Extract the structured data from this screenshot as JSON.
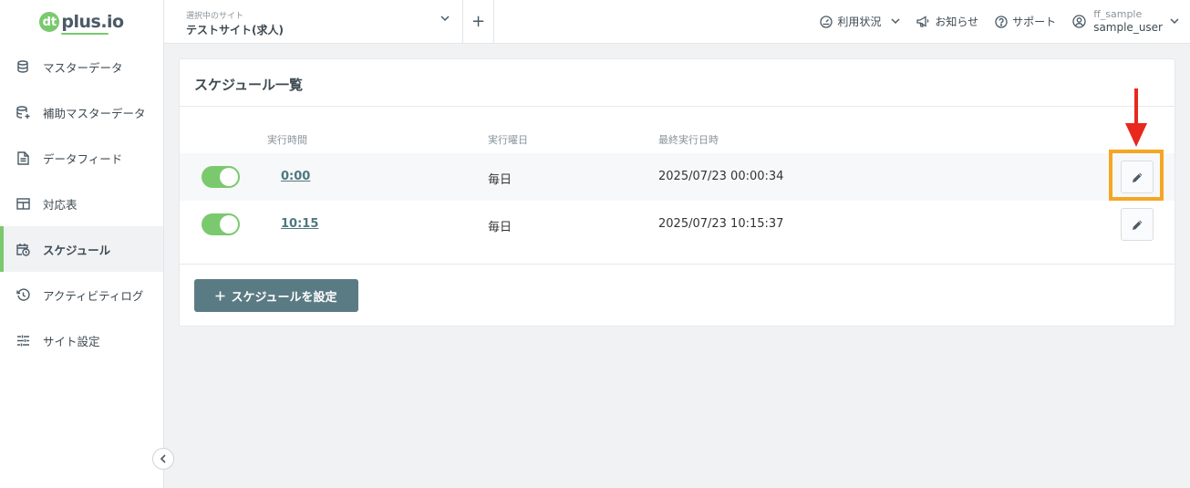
{
  "logo": {
    "mark": "dt",
    "text": "plus.io"
  },
  "sidebar": {
    "items": [
      {
        "label": "マスターデータ",
        "icon": "database-icon"
      },
      {
        "label": "補助マスターデータ",
        "icon": "database-plus-icon"
      },
      {
        "label": "データフィード",
        "icon": "file-icon"
      },
      {
        "label": "対応表",
        "icon": "table-icon"
      },
      {
        "label": "スケジュール",
        "icon": "calendar-clock-icon",
        "active": true
      },
      {
        "label": "アクティビティログ",
        "icon": "history-icon"
      },
      {
        "label": "サイト設定",
        "icon": "sliders-icon"
      }
    ]
  },
  "header": {
    "site_label": "選択中のサイト",
    "site_name": "テストサイト(求人)",
    "add_site": "+",
    "usage": "利用状況",
    "news": "お知らせ",
    "support": "サポート",
    "user_top": "ff_sample",
    "user_bottom": "sample_user"
  },
  "schedule": {
    "title": "スケジュール一覧",
    "columns": [
      "実行時間",
      "実行曜日",
      "最終実行日時"
    ],
    "rows": [
      {
        "enabled": true,
        "time": "0:00",
        "day": "毎日",
        "last_run": "2025/07/23 00:00:34"
      },
      {
        "enabled": true,
        "time": "10:15",
        "day": "毎日",
        "last_run": "2025/07/23 10:15:37"
      }
    ],
    "add_button": "スケジュールを設定"
  },
  "colors": {
    "accent_green": "#7ac96e",
    "button_slate": "#5b7b84",
    "highlight_orange": "#f5a623",
    "arrow_red": "#e8281c"
  }
}
